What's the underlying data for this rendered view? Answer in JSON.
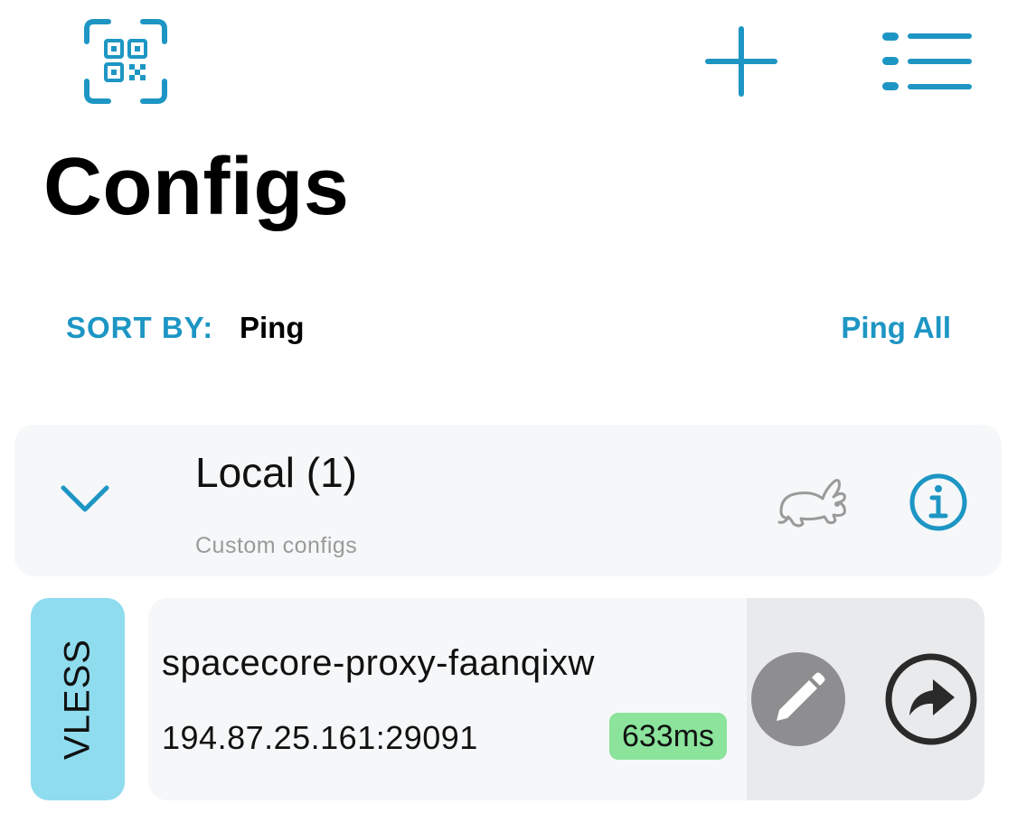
{
  "header": {
    "title": "Configs",
    "icons": {
      "scan": "qr-scan-icon",
      "add": "plus-icon",
      "menu": "list-menu-icon"
    }
  },
  "sort": {
    "label": "SORT BY:",
    "value": "Ping"
  },
  "actions": {
    "ping_all": "Ping All"
  },
  "group": {
    "title": "Local (1)",
    "subtitle": "Custom configs",
    "expanded": true,
    "icons": {
      "collapse": "chevron-down-icon",
      "speed": "rabbit-icon",
      "info": "info-icon"
    }
  },
  "configs": [
    {
      "protocol": "VLESS",
      "name": "spacecore-proxy-faanqixw",
      "address": "194.87.25.161:29091",
      "ping": "633ms",
      "icons": {
        "edit": "pencil-icon",
        "share": "share-arrow-icon"
      }
    }
  ],
  "colors": {
    "accent": "#1d96c4",
    "card_bg": "#f5f7f8",
    "protocol_badge": "#8fdcee",
    "ping_good": "#8be39c",
    "edit_button": "#8e8e90"
  }
}
